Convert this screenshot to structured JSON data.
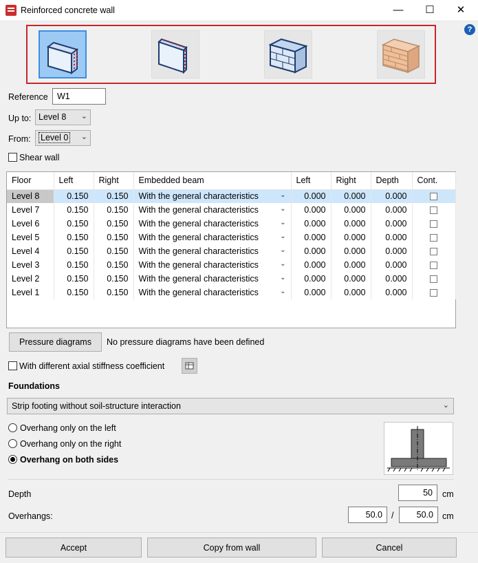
{
  "window": {
    "title": "Reinforced concrete wall",
    "min_glyph": "—",
    "max_glyph": "☐",
    "close_glyph": "✕",
    "help_glyph": "?"
  },
  "wall_types": [
    {
      "name": "reinforced-concrete-wall-type",
      "selected": true
    },
    {
      "name": "reinforced-concrete-wall-alt-type",
      "selected": false
    },
    {
      "name": "block-masonry-wall-type",
      "selected": false
    },
    {
      "name": "brick-masonry-wall-type",
      "selected": false
    }
  ],
  "form": {
    "reference_label": "Reference",
    "reference_value": "W1",
    "up_to_label": "Up to:",
    "up_to_value": "Level 8",
    "from_label": "From:",
    "from_value": "Level 0",
    "shear_wall_label": "Shear wall"
  },
  "table": {
    "headers": [
      "Floor",
      "Left",
      "Right",
      "Embedded beam",
      "Left",
      "Right",
      "Depth",
      "Cont."
    ],
    "rows": [
      {
        "floor": "Level 8",
        "left": "0.150",
        "right": "0.150",
        "beam": "With the general characteristics",
        "b_left": "0.000",
        "b_right": "0.000",
        "depth": "0.000"
      },
      {
        "floor": "Level 7",
        "left": "0.150",
        "right": "0.150",
        "beam": "With the general characteristics",
        "b_left": "0.000",
        "b_right": "0.000",
        "depth": "0.000"
      },
      {
        "floor": "Level 6",
        "left": "0.150",
        "right": "0.150",
        "beam": "With the general characteristics",
        "b_left": "0.000",
        "b_right": "0.000",
        "depth": "0.000"
      },
      {
        "floor": "Level 5",
        "left": "0.150",
        "right": "0.150",
        "beam": "With the general characteristics",
        "b_left": "0.000",
        "b_right": "0.000",
        "depth": "0.000"
      },
      {
        "floor": "Level 4",
        "left": "0.150",
        "right": "0.150",
        "beam": "With the general characteristics",
        "b_left": "0.000",
        "b_right": "0.000",
        "depth": "0.000"
      },
      {
        "floor": "Level 3",
        "left": "0.150",
        "right": "0.150",
        "beam": "With the general characteristics",
        "b_left": "0.000",
        "b_right": "0.000",
        "depth": "0.000"
      },
      {
        "floor": "Level 2",
        "left": "0.150",
        "right": "0.150",
        "beam": "With the general characteristics",
        "b_left": "0.000",
        "b_right": "0.000",
        "depth": "0.000"
      },
      {
        "floor": "Level 1",
        "left": "0.150",
        "right": "0.150",
        "beam": "With the general characteristics",
        "b_left": "0.000",
        "b_right": "0.000",
        "depth": "0.000"
      }
    ]
  },
  "pressure": {
    "button_label": "Pressure diagrams",
    "status": "No pressure diagrams have been defined"
  },
  "axial": {
    "label": "With different axial stiffness coefficient"
  },
  "foundations": {
    "heading": "Foundations",
    "type_value": "Strip footing without soil-structure interaction",
    "options": [
      {
        "label": "Overhang only on the left",
        "checked": false
      },
      {
        "label": "Overhang only on the right",
        "checked": false
      },
      {
        "label": "Overhang on both sides",
        "checked": true
      }
    ],
    "depth_label": "Depth",
    "depth_value": "50",
    "depth_unit": "cm",
    "overhangs_label": "Overhangs:",
    "overhang_left": "50.0",
    "overhang_sep": "/",
    "overhang_right": "50.0",
    "overhang_unit": "cm"
  },
  "buttons": {
    "accept": "Accept",
    "copy": "Copy from wall",
    "cancel": "Cancel"
  }
}
